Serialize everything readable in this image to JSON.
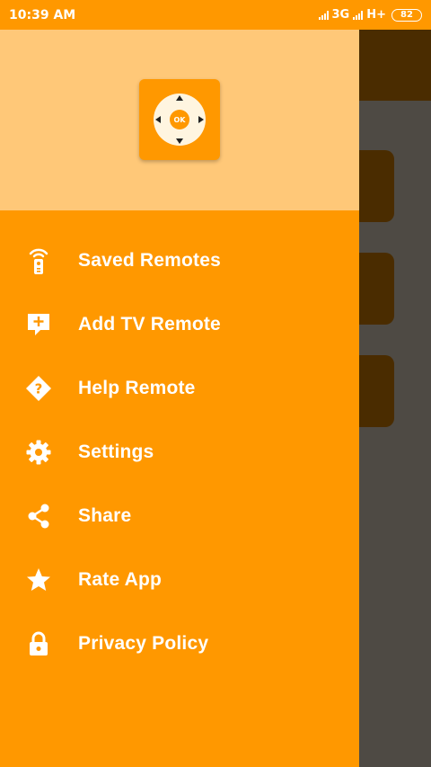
{
  "status_bar": {
    "time": "10:39 AM",
    "network_1": "3G",
    "network_2": "H+",
    "battery": "82"
  },
  "drawer": {
    "logo_text": "OK",
    "menu": [
      {
        "label": "Saved Remotes",
        "icon": "remote-wifi-icon"
      },
      {
        "label": "Add TV Remote",
        "icon": "add-comment-icon"
      },
      {
        "label": "Help Remote",
        "icon": "help-diamond-icon"
      },
      {
        "label": "Settings",
        "icon": "gear-icon"
      },
      {
        "label": "Share",
        "icon": "share-icon"
      },
      {
        "label": "Rate App",
        "icon": "star-icon"
      },
      {
        "label": "Privacy Policy",
        "icon": "lock-icon"
      }
    ]
  },
  "colors": {
    "accent": "#ff9800",
    "header": "#ffc878",
    "background_dim": "#4e4a44",
    "background_dark": "#4a2c00"
  }
}
